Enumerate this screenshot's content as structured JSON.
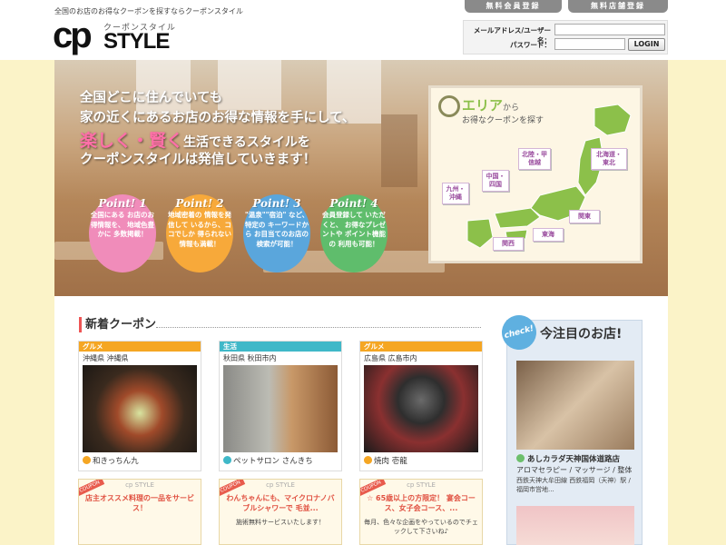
{
  "header": {
    "tagline": "全国のお店のお得なクーポンを探すならクーポンスタイル",
    "logo_cp": "cp",
    "logo_sub": "クーポンスタイル",
    "logo_style": "STYLE",
    "reg_member": "無料会員登録",
    "reg_shop": "無料店舗登録",
    "login": {
      "email_label": "メールアドレス/ユーザー名：",
      "password_label": "パスワード：",
      "email_value": "",
      "password_value": "",
      "button": "LOGIN"
    }
  },
  "hero": {
    "line1": "全国どこに住んでいても",
    "line2": "家の近くにあるお店のお得な情報を手にして、",
    "line3_pink": "楽しく・賢く",
    "line3_rest": "生活できるスタイルを",
    "line4": "クーポンスタイルは発信していきます！",
    "points": [
      {
        "head": "Point! 1",
        "body": "全国にある お店のお得情報を、 地域色豊かに 多数掲載！"
      },
      {
        "head": "Point! 2",
        "body": "地域密着の 情報を発信して いるから、ココでしか 得られない 情報も満載！"
      },
      {
        "head": "Point! 3",
        "body": "\"温泉\"\"宿泊\" など、特定の キーワードから お目当てのお店の 検索が可能！"
      },
      {
        "head": "Point! 4",
        "body": "会員登録して いただくと、 お得なプレゼントや ポイント機能の 利用も可能！"
      }
    ],
    "area": {
      "title": "エリア",
      "title_suffix": "から",
      "subtitle": "お得なクーポンを探す",
      "regions": [
        "北海道・東北",
        "北陸・甲信越",
        "中国・四国",
        "九州・沖縄",
        "関東",
        "東海",
        "関西"
      ]
    }
  },
  "new_coupons": {
    "title": "新着クーポン",
    "cards": [
      {
        "category": "グルメ",
        "location": "沖縄県 沖縄県",
        "name": "和きっちん九"
      },
      {
        "category": "生活",
        "location": "秋田県 秋田市内",
        "name": "ペットサロン さんきち"
      },
      {
        "category": "グルメ",
        "location": "広島県 広島市内",
        "name": "焼肉 壱龍"
      }
    ],
    "coupons": [
      {
        "header": "cp STYLE",
        "tag": "COUPON",
        "main": "店主オススメ料理の一品をサービス！",
        "sub": ""
      },
      {
        "header": "cp STYLE",
        "tag": "COUPON",
        "main": "わんちゃんにも、マイクロナノバブルシャワーで 毛並...",
        "sub": "施術無料サービスいたします！"
      },
      {
        "header": "cp STYLE",
        "tag": "COUPON",
        "main": "☆ 65歳以上の方限定！ 宴会コース、女子会コース、...",
        "sub": "毎月、色々な企画をやっているのでチェックして下さいね♪"
      }
    ]
  },
  "featured": {
    "check": "check!",
    "title": "今注目のお店!",
    "shop_name": "あしカラダ天神国体道路店",
    "shop_category": "アロマセラピー / マッサージ / 整体",
    "shop_address": "西鉄天神大牟田線 西鉄福岡（天神）駅 / 福岡市営地..."
  },
  "colors": {
    "band": "#fbf3c8",
    "gourmet": "#f5a623",
    "life": "#3fb8c8",
    "point1": "#f08cba",
    "point2": "#f7a93a",
    "point3": "#5aa6dc",
    "point4": "#5fbd6c",
    "map_green": "#8cc04a"
  }
}
